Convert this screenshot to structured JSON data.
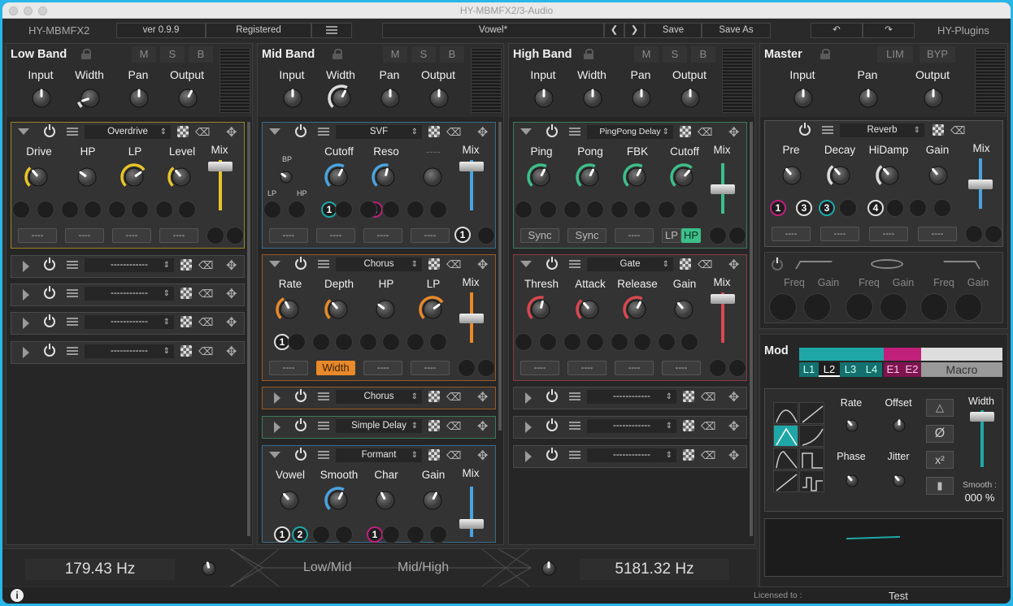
{
  "window": {
    "title": "HY-MBMFX2/3-Audio"
  },
  "topbar": {
    "plugin": "HY-MBMFX2",
    "version": "ver 0.9.9",
    "registered": "Registered",
    "preset": "Vowel*",
    "save": "Save",
    "save_as": "Save As",
    "brand": "HY-Plugins"
  },
  "bands": [
    {
      "title": "Low Band",
      "m": "M",
      "s": "S",
      "b": "B",
      "params": [
        "Input",
        "Width",
        "Pan",
        "Output"
      ],
      "module": {
        "name": "Overdrive",
        "color": "#e8c42a",
        "labels": [
          "Drive",
          "HP",
          "LP",
          "Level",
          "Mix"
        ],
        "buttons": [
          "----",
          "----",
          "----",
          "----"
        ]
      },
      "empty_slots": [
        "------------",
        "------------",
        "------------",
        "------------"
      ]
    },
    {
      "title": "Mid Band",
      "m": "M",
      "s": "S",
      "b": "B",
      "params": [
        "Input",
        "Width",
        "Pan",
        "Output"
      ],
      "module1": {
        "name": "SVF",
        "color": "#4aa3df",
        "labels": [
          "Cutoff",
          "Reso",
          "----",
          "Mix"
        ],
        "mode_bp": "BP",
        "mode_lp": "LP",
        "mode_hp": "HP",
        "buttons": [
          "----",
          "----",
          "----",
          "----"
        ],
        "badges": [
          "1",
          "2",
          "1"
        ]
      },
      "module2": {
        "name": "Chorus",
        "color": "#e8892a",
        "labels": [
          "Rate",
          "Depth",
          "HP",
          "LP",
          "Mix"
        ],
        "buttons": [
          "----",
          "Width",
          "----",
          "----"
        ],
        "badge": "1"
      },
      "collapsed": [
        "Chorus",
        "Simple Delay"
      ],
      "module3": {
        "name": "Formant",
        "labels": [
          "Vowel",
          "Smooth",
          "Char",
          "Gain",
          "Mix"
        ],
        "badges": [
          "1",
          "2",
          "1"
        ]
      }
    },
    {
      "title": "High Band",
      "m": "M",
      "s": "S",
      "b": "B",
      "params": [
        "Input",
        "Width",
        "Pan",
        "Output"
      ],
      "module1": {
        "name": "PingPong Delay",
        "color": "#3dbf8a",
        "labels": [
          "Ping",
          "Pong",
          "FBK",
          "Cutoff",
          "Mix"
        ],
        "buttons": [
          "Sync",
          "Sync",
          "----"
        ],
        "lp": "LP",
        "hp": "HP"
      },
      "module2": {
        "name": "Gate",
        "color": "#d9484f",
        "labels": [
          "Thresh",
          "Attack",
          "Release",
          "Gain",
          "Mix"
        ],
        "buttons": [
          "----",
          "----",
          "----",
          "----"
        ]
      },
      "empty_slots": [
        "------------",
        "------------",
        "------------"
      ]
    },
    {
      "title": "Master",
      "lim": "LIM",
      "byp": "BYP",
      "params": [
        "Input",
        "Pan",
        "Output"
      ],
      "module": {
        "name": "Reverb",
        "labels": [
          "Pre",
          "Decay",
          "HiDamp",
          "Gain",
          "Mix"
        ],
        "buttons": [
          "----",
          "----",
          "----",
          "----"
        ],
        "badges": [
          "1",
          "3",
          "3",
          "4"
        ]
      },
      "eq_labels": [
        "Freq",
        "Gain",
        "Freq",
        "Gain",
        "Freq",
        "Gain"
      ]
    }
  ],
  "mod": {
    "title": "Mod",
    "tabs": [
      "L1",
      "L2",
      "L3",
      "L4",
      "E1",
      "E2",
      "Macro"
    ],
    "active_tab": "L2",
    "labels": {
      "rate": "Rate",
      "offset": "Offset",
      "phase": "Phase",
      "jitter": "Jitter",
      "width": "Width",
      "smooth": "Smooth :",
      "smooth_value": "000 %"
    }
  },
  "bottom": {
    "low_mid_freq": "179.43 Hz",
    "low_mid": "Low/Mid",
    "mid_high": "Mid/High",
    "mid_high_freq": "5181.32 Hz"
  },
  "footer": {
    "licensed": "Licensed to :",
    "user": "Test"
  },
  "colors": {
    "accent_yellow": "#e8c42a",
    "accent_blue": "#4aa3df",
    "accent_orange": "#e8892a",
    "accent_green": "#3dbf8a",
    "accent_red": "#d9484f",
    "accent_teal": "#1fa7a7",
    "accent_magenta": "#c01f7a"
  }
}
